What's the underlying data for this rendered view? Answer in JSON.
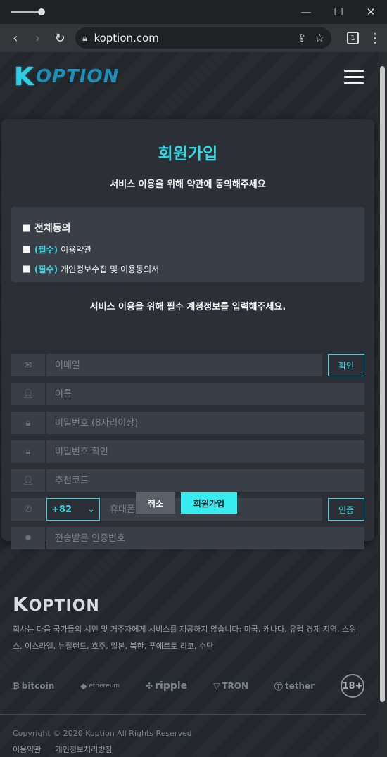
{
  "browser": {
    "url": "koption.com",
    "tab_count": "1",
    "icons": {
      "back": "back-arrow-icon",
      "forward": "forward-arrow-icon",
      "reload": "reload-icon",
      "lock": "lock-icon",
      "share": "share-icon",
      "bookmark": "bookmark-icon",
      "menu": "kebab-menu-icon"
    }
  },
  "site": {
    "logo_k": "K",
    "logo_rest": "OPTION"
  },
  "signup": {
    "title": "회원가입",
    "subtitle": "서비스 이용을 위해 약관에 동의해주세요",
    "agree_all": "전체동의",
    "terms_required": "(필수)",
    "terms_label": "이용약관",
    "privacy_required": "(필수)",
    "privacy_label": "개인정보수집 및 이용동의서",
    "info_title": "서비스 이용을 위해 필수 계정정보를 입력해주세요.",
    "email_placeholder": "이메일",
    "email_confirm": "확인",
    "name_placeholder": "이름",
    "password_placeholder": "비밀번호 (8자리이상)",
    "password_confirm_placeholder": "비밀번호 확인",
    "referral_placeholder": "추천코드",
    "country_code": "+82",
    "phone_placeholder": "휴대폰 번호",
    "phone_verify": "인증",
    "code_placeholder": "전송받은 인증번호",
    "cancel_label": "취소",
    "submit_label": "회원가입"
  },
  "footer": {
    "logo_k": "K",
    "logo_rest": "OPTION",
    "description": "회사는 다음 국가들의 시민 및 거주자에게 서비스를 제공하지 않습니다: 미국, 캐나다, 유럽 경제 지역, 스위스, 이스라엘, 뉴질랜드, 호주, 일본, 북한, 푸에르토 리코, 수단",
    "brands": [
      "bitcoin",
      "ethereum",
      "ripple",
      "TRON",
      "tether"
    ],
    "age_badge": "18+",
    "copyright": "Copyright © 2020 Koption All Rights Reserved",
    "link_terms": "이용약관",
    "link_privacy": "개인정보처리방침"
  },
  "colors": {
    "accent": "#35d3dd",
    "submit_bg": "#37ecf0",
    "card_bg": "#2c3036",
    "input_bg": "#3a3f47"
  }
}
